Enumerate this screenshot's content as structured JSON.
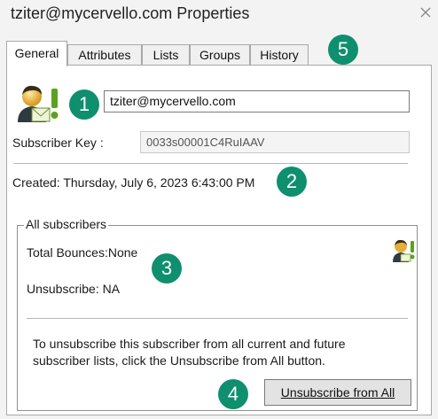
{
  "window": {
    "title": "tziter@mycervello.com Properties",
    "close_icon": "close-icon"
  },
  "tabs": [
    {
      "label": "General",
      "active": true
    },
    {
      "label": "Attributes",
      "active": false
    },
    {
      "label": "Lists",
      "active": false
    },
    {
      "label": "Groups",
      "active": false
    },
    {
      "label": "History",
      "active": false
    }
  ],
  "general": {
    "subscriber_icon": "subscriber-person-mail-icon",
    "email_value": "tziter@mycervello.com",
    "subscriber_key_label": "Subscriber Key :",
    "subscriber_key_value": "0033s00001C4RuIAAV",
    "created_text": "Created: Thursday, July 6, 2023 6:43:00 PM"
  },
  "all_subscribers": {
    "legend": "All subscribers",
    "total_bounces": "Total Bounces:None",
    "unsubscribe_status": "Unsubscribe: NA",
    "message": "To unsubscribe this subscriber from all current and future subscriber lists, click the Unsubscribe from All button.",
    "button_label": "Unsubscribe from All",
    "small_icon": "subscriber-small-icon"
  },
  "callouts": [
    "1",
    "2",
    "3",
    "4",
    "5"
  ],
  "colors": {
    "callout_badge": "#0e8f6e",
    "panel": "#ffffff",
    "background": "#f3f3f3"
  }
}
